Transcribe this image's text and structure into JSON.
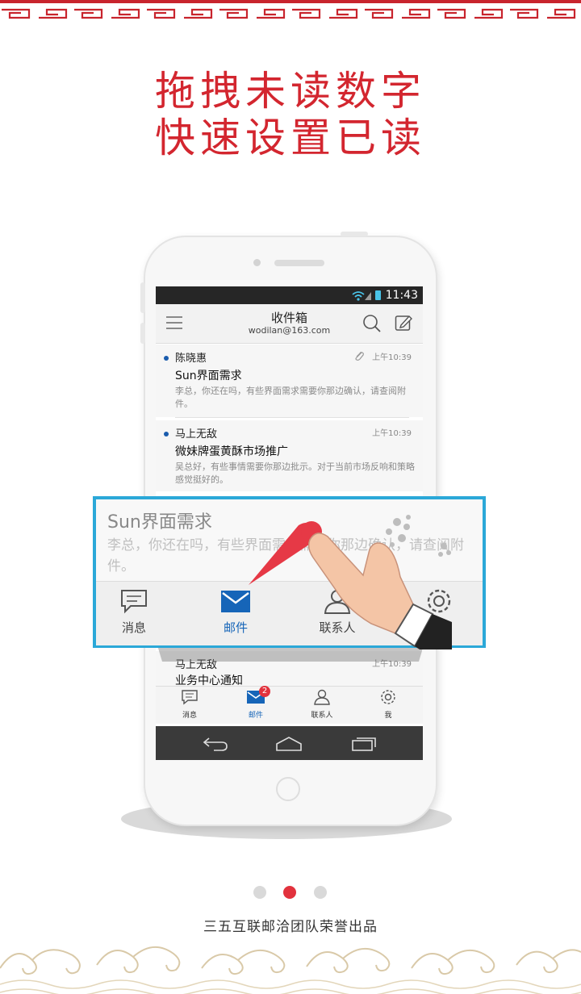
{
  "headline": {
    "line1": "拖拽未读数字",
    "line2": "快速设置已读"
  },
  "colors": {
    "accent_red": "#d3262f",
    "popup_border": "#2ba8d8",
    "active_blue": "#1665b8",
    "unread_dot": "#1a5cad"
  },
  "phone": {
    "status_time": "11:43",
    "inbox_title": "收件箱",
    "account": "wodilan@163.com",
    "mails": [
      {
        "sender": "陈晓惠",
        "time": "上午10:39",
        "subject": "Sun界面需求",
        "preview": "李总，你还在吗，有些界面需求需要你那边确认，请查阅附件。",
        "unread": true,
        "attachment": true
      },
      {
        "sender": "马上无敌",
        "time": "上午10:39",
        "subject": "微妹牌蛋黄酥市场推广",
        "preview": "吴总好，有些事情需要你那边批示。对于当前市场反响和策略感觉挺好的。",
        "unread": true,
        "attachment": false
      },
      {
        "sender": "马上无敌",
        "time": "上午10:39",
        "subject": "业务中心通知",
        "preview": "",
        "unread": false,
        "attachment": false
      }
    ],
    "tabs": [
      {
        "label": "消息",
        "icon": "message-icon"
      },
      {
        "label": "邮件",
        "icon": "mail-icon",
        "badge": "2"
      },
      {
        "label": "联系人",
        "icon": "contact-icon"
      },
      {
        "label": "我",
        "icon": "gear-icon"
      }
    ]
  },
  "popup": {
    "subject": "Sun界面需求",
    "preview": "李总，你还在吗，有些界面需求需要你那边确认，请查阅附件。",
    "tabs": [
      {
        "label": "消息",
        "icon": "message-icon"
      },
      {
        "label": "邮件",
        "icon": "mail-icon"
      },
      {
        "label": "联系人",
        "icon": "contact-icon"
      },
      {
        "label": "我",
        "icon": "gear-icon"
      }
    ]
  },
  "pagination": {
    "count": 3,
    "active_index": 1
  },
  "footer": {
    "credit": "三五互联邮洽团队荣誉出品"
  }
}
